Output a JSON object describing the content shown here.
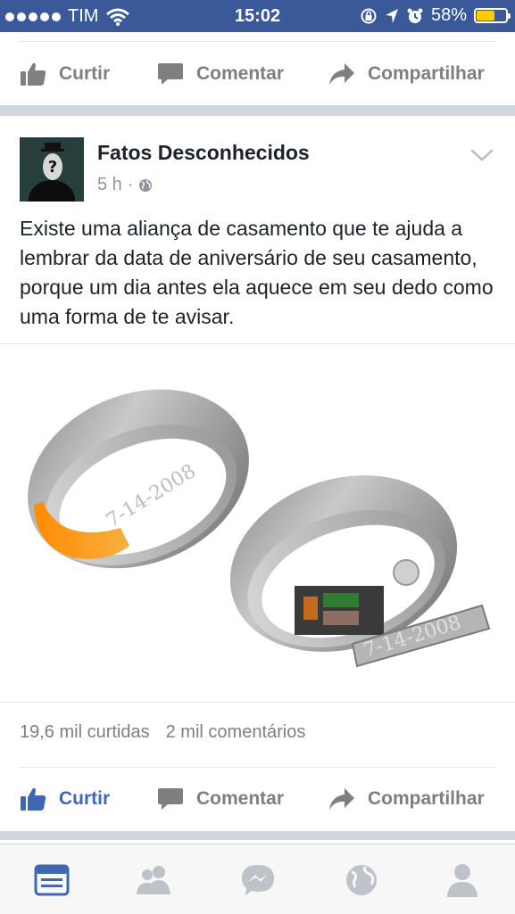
{
  "status_bar": {
    "carrier": "TIM",
    "time": "15:02",
    "battery_percent": "58%",
    "battery_level": 0.58,
    "icons": [
      "signal-dots-icon",
      "wifi-icon",
      "orientation-lock-icon",
      "location-arrow-icon",
      "alarm-icon",
      "battery-icon"
    ]
  },
  "top_actions": {
    "like_label": "Curtir",
    "comment_label": "Comentar",
    "share_label": "Compartilhar"
  },
  "post": {
    "page_name": "Fatos Desconhecidos",
    "time_ago": "5 h",
    "separator": "·",
    "audience_icon": "globe-icon",
    "text": "Existe uma aliança de casamento que te ajuda a lembrar da data de aniversário de seu casamento, porque um dia antes ela aquece em seu dedo como uma forma de te avisar.",
    "image": {
      "ring_engraving_left": "7-14-2008",
      "ring_engraving_right": "7-14-2008"
    },
    "likes": "19,6 mil curtidas",
    "comments": "2 mil comentários",
    "actions": {
      "like_label": "Curtir",
      "like_active": true,
      "comment_label": "Comentar",
      "share_label": "Compartilhar"
    }
  },
  "tab_bar": {
    "tabs": [
      "news-feed-icon",
      "friends-icon",
      "messenger-icon",
      "globe-icon",
      "profile-icon"
    ],
    "active_tab": "news-feed-icon",
    "active_color": "#4267b2",
    "inactive_color": "#bec2c9"
  },
  "colors": {
    "brand_blue": "#3b5998",
    "link_blue": "#4267b2",
    "secondary_text": "#90949c"
  }
}
